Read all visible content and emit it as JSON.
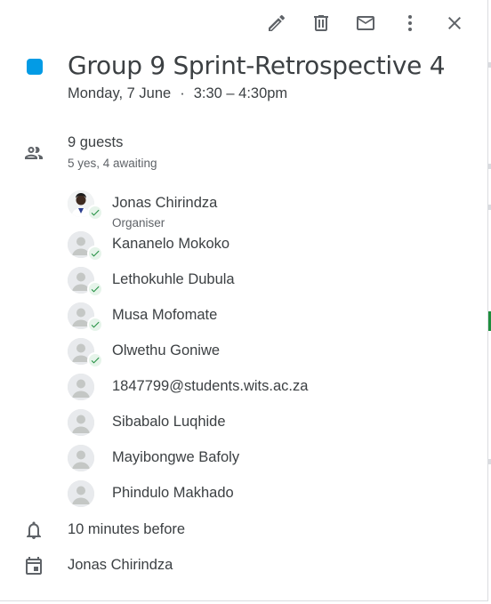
{
  "toolbar": {
    "edit_icon": "pencil-icon",
    "delete_icon": "trash-icon",
    "email_icon": "envelope-icon",
    "more_icon": "more-vert-icon",
    "close_icon": "close-icon"
  },
  "event": {
    "color": "#039be5",
    "title": "Group 9 Sprint-Retrospective 4",
    "date": "Monday, 7 June",
    "separator": "·",
    "time": "3:30 – 4:30pm"
  },
  "guests": {
    "count_label": "9 guests",
    "status_label": "5 yes, 4 awaiting",
    "list": [
      {
        "name": "Jonas Chirindza",
        "role": "Organiser",
        "accepted": true,
        "photo": true
      },
      {
        "name": "Kananelo Mokoko",
        "accepted": true
      },
      {
        "name": "Lethokuhle Dubula",
        "accepted": true
      },
      {
        "name": "Musa Mofomate",
        "accepted": true
      },
      {
        "name": "Olwethu Goniwe",
        "accepted": true
      },
      {
        "name": "1847799@students.wits.ac.za",
        "accepted": false
      },
      {
        "name": "Sibabalo Luqhide",
        "accepted": false
      },
      {
        "name": "Mayibongwe Bafoly",
        "accepted": false
      },
      {
        "name": "Phindulo Makhado",
        "accepted": false
      }
    ]
  },
  "reminder": {
    "label": "10 minutes before",
    "icon": "bell-icon"
  },
  "calendar": {
    "label": "Jonas Chirindza",
    "icon": "calendar-icon"
  },
  "colors": {
    "accepted_green": "#1e8e3e",
    "text": "#3c4043",
    "secondary": "#5f6368"
  }
}
